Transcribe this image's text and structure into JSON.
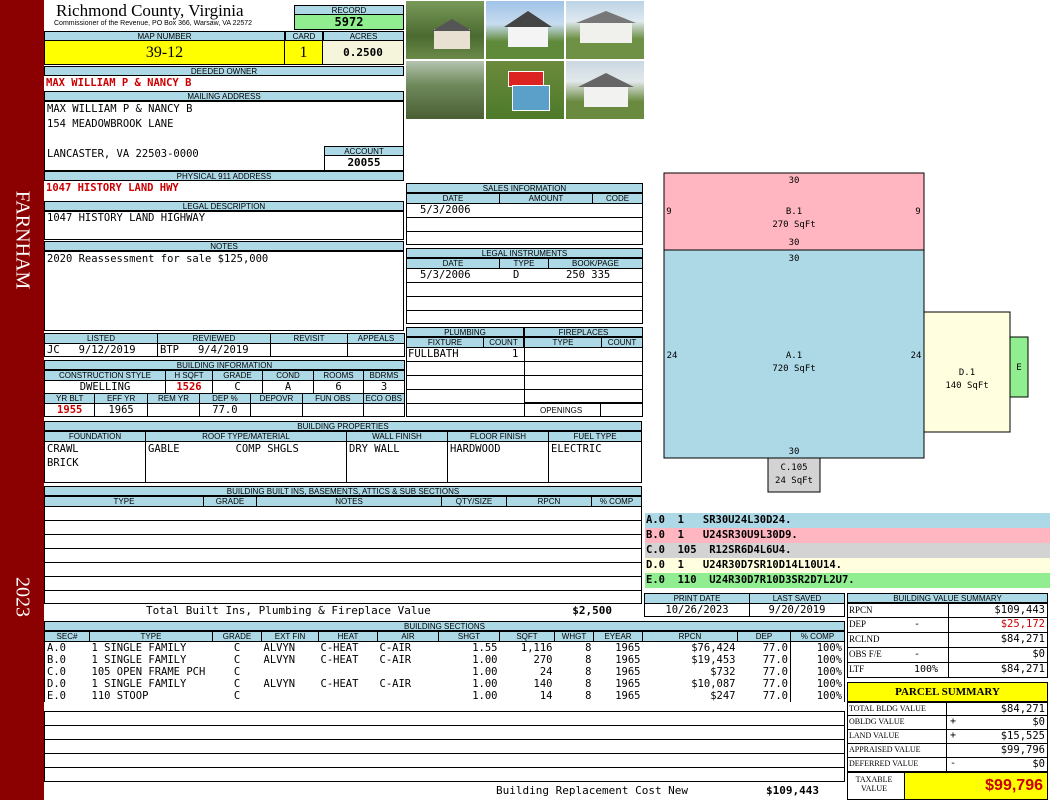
{
  "sidebar": {
    "location": "FARNHAM",
    "year": "2023"
  },
  "header": {
    "county": "Richmond County, Virginia",
    "commissioner": "Commissioner of the Revenue, PO Box 366, Warsaw, VA 22572",
    "record_label": "RECORD",
    "record": "5972",
    "map_label": "MAP NUMBER",
    "map_number": "39-12",
    "card_label": "CARD",
    "card": "1",
    "acres_label": "ACRES",
    "acres": "0.2500"
  },
  "owner": {
    "deeded_label": "DEEDED OWNER",
    "deeded": "MAX WILLIAM P & NANCY B",
    "mailing_label": "MAILING ADDRESS",
    "mailing": [
      "MAX WILLIAM P & NANCY B",
      "154 MEADOWBROOK LANE",
      "",
      "LANCASTER, VA 22503-0000"
    ],
    "account_label": "ACCOUNT",
    "account": "20055",
    "physical_label": "PHYSICAL 911 ADDRESS",
    "physical": "1047 HISTORY LAND HWY",
    "legal_label": "LEGAL DESCRIPTION",
    "legal": "1047 HISTORY LAND HIGHWAY",
    "notes_label": "NOTES",
    "notes": "2020 Reassessment for sale $125,000"
  },
  "review": {
    "headers": [
      "LISTED",
      "REVIEWED",
      "REVISIT",
      "APPEALS"
    ],
    "listed_by": "JC",
    "listed_date": "9/12/2019",
    "reviewed_by": "BTP",
    "reviewed_date": "9/4/2019"
  },
  "building_info": {
    "title": "BUILDING INFORMATION",
    "headers": [
      "CONSTRUCTION STYLE",
      "H SQFT",
      "GRADE",
      "COND",
      "ROOMS",
      "BDRMS"
    ],
    "values": [
      "DWELLING",
      "1526",
      "C",
      "A",
      "6",
      "3"
    ],
    "headers2": [
      "YR BLT",
      "EFF YR",
      "REM YR",
      "DEP %",
      "DEPOVR",
      "FUN OBS",
      "ECO OBS"
    ],
    "values2": [
      "1955",
      "1965",
      "",
      "77.0",
      "",
      "",
      ""
    ]
  },
  "sales": {
    "title": "SALES INFORMATION",
    "headers": [
      "DATE",
      "AMOUNT",
      "CODE"
    ],
    "rows": [
      [
        "5/3/2006",
        "",
        ""
      ]
    ]
  },
  "legal_instruments": {
    "title": "LEGAL INSTRUMENTS",
    "headers": [
      "DATE",
      "TYPE",
      "BOOK/PAGE"
    ],
    "rows": [
      [
        "5/3/2006",
        "D",
        "250 335"
      ]
    ]
  },
  "plumbing": {
    "title": "PLUMBING",
    "headers": [
      "FIXTURE",
      "COUNT"
    ],
    "rows": [
      [
        "FULLBATH",
        "1"
      ]
    ]
  },
  "fireplaces": {
    "title": "FIREPLACES",
    "headers": [
      "TYPE",
      "COUNT"
    ],
    "openings_label": "OPENINGS"
  },
  "building_props": {
    "title": "BUILDING PROPERTIES",
    "headers": [
      "FOUNDATION",
      "ROOF TYPE/MATERIAL",
      "WALL FINISH",
      "FLOOR FINISH",
      "FUEL TYPE"
    ],
    "foundation": [
      "CRAWL",
      "BRICK"
    ],
    "roof_type": "GABLE",
    "roof_material": "COMP SHGLS",
    "wall": "DRY WALL",
    "floor": "HARDWOOD",
    "fuel": "ELECTRIC"
  },
  "built_ins": {
    "title": "BUILDING BUILT INS, BASEMENTS, ATTICS & SUB SECTIONS",
    "headers": [
      "TYPE",
      "GRADE",
      "NOTES",
      "QTY/SIZE",
      "RPCN",
      "% COMP"
    ],
    "total_label": "Total Built Ins, Plumbing & Fireplace Value",
    "total": "$2,500"
  },
  "sketch": {
    "sections": [
      {
        "id": "B.1",
        "sqft": "270 SqFt",
        "color": "#ffb6c1"
      },
      {
        "id": "A.1",
        "sqft": "720 SqFt",
        "color": "#add8e6"
      },
      {
        "id": "D.1",
        "sqft": "140 SqFt",
        "color": "#ffffe0"
      },
      {
        "id": "C.105",
        "sqft": "24 SqFt",
        "color": "#d3d3d3"
      },
      {
        "id": "E",
        "sqft": "",
        "color": "#90ee90"
      }
    ],
    "dims": {
      "b_top": "30",
      "b_bottom": "30",
      "b_left": "9",
      "b_right": "9",
      "a_top": "30",
      "a_bottom": "30",
      "a_left": "24",
      "a_right": "24"
    }
  },
  "legend": [
    {
      "text": "A.0  1   SR30U24L30D24.",
      "color": "#add8e6"
    },
    {
      "text": "B.0  1   U24SR30U9L30D9.",
      "color": "#ffb6c1"
    },
    {
      "text": "C.0  105  R12SR6D4L6U4.",
      "color": "#d3d3d3"
    },
    {
      "text": "D.0  1   U24R30D7SR10D14L10U14.",
      "color": "#ffffe0"
    },
    {
      "text": "E.0  110  U24R30D7R10D3SR2D7L2U7.",
      "color": "#90ee90"
    }
  ],
  "print_info": {
    "print_label": "PRINT DATE",
    "print_date": "10/26/2023",
    "saved_label": "LAST SAVED",
    "saved_date": "9/20/2019"
  },
  "building_sections": {
    "title": "BUILDING SECTIONS",
    "headers": [
      "SEC#",
      "TYPE",
      "GRADE",
      "EXT FIN",
      "HEAT",
      "AIR",
      "SHGT",
      "SQFT",
      "WHGT",
      "EYEAR",
      "RPCN",
      "DEP",
      "% COMP"
    ],
    "rows": [
      [
        "A.0",
        "1 SINGLE FAMILY",
        "C",
        "ALVYN",
        "C-HEAT",
        "C-AIR",
        "1.55",
        "1,116",
        "8",
        "1965",
        "$76,424",
        "77.0",
        "100%"
      ],
      [
        "B.0",
        "1 SINGLE FAMILY",
        "C",
        "ALVYN",
        "C-HEAT",
        "C-AIR",
        "1.00",
        "270",
        "8",
        "1965",
        "$19,453",
        "77.0",
        "100%"
      ],
      [
        "C.0",
        "105 OPEN FRAME PCH",
        "C",
        "",
        "",
        "",
        "1.00",
        "24",
        "8",
        "1965",
        "$732",
        "77.0",
        "100%"
      ],
      [
        "D.0",
        "1 SINGLE FAMILY",
        "C",
        "ALVYN",
        "C-HEAT",
        "C-AIR",
        "1.00",
        "140",
        "8",
        "1965",
        "$10,087",
        "77.0",
        "100%"
      ],
      [
        "E.0",
        "110 STOOP",
        "C",
        "",
        "",
        "",
        "1.00",
        "14",
        "8",
        "1965",
        "$247",
        "77.0",
        "100%"
      ]
    ],
    "total_label": "Building Replacement Cost New",
    "total": "$109,443"
  },
  "value_summary": {
    "title": "BUILDING VALUE SUMMARY",
    "rows": [
      {
        "label": "RPCN",
        "op": "",
        "value": "$109,443"
      },
      {
        "label": "DEP",
        "op": "-",
        "value": "$25,172",
        "red": true
      },
      {
        "label": "RCLND",
        "op": "",
        "value": "$84,271"
      },
      {
        "label": "OBS F/E",
        "op": "-",
        "value": "$0"
      },
      {
        "label": "LTF",
        "op": "100%",
        "value": "$84,271"
      }
    ]
  },
  "parcel": {
    "title": "PARCEL SUMMARY",
    "rows": [
      {
        "label": "TOTAL BLDG VALUE",
        "op": "",
        "value": "$84,271"
      },
      {
        "label": "OBLDG VALUE",
        "op": "+",
        "value": "$0"
      },
      {
        "label": "LAND VALUE",
        "op": "+",
        "value": "$15,525"
      },
      {
        "label": "APPRAISED VALUE",
        "op": "",
        "value": "$99,796"
      },
      {
        "label": "DEFERRED VALUE",
        "op": "-",
        "value": "$0"
      }
    ],
    "taxable_label": "TAXABLE VALUE",
    "taxable": "$99,796"
  },
  "colors": {
    "sidebar": "#8b0000",
    "header_blue": "#add8e6",
    "yellow": "#ffff00",
    "green": "#90ee90"
  }
}
